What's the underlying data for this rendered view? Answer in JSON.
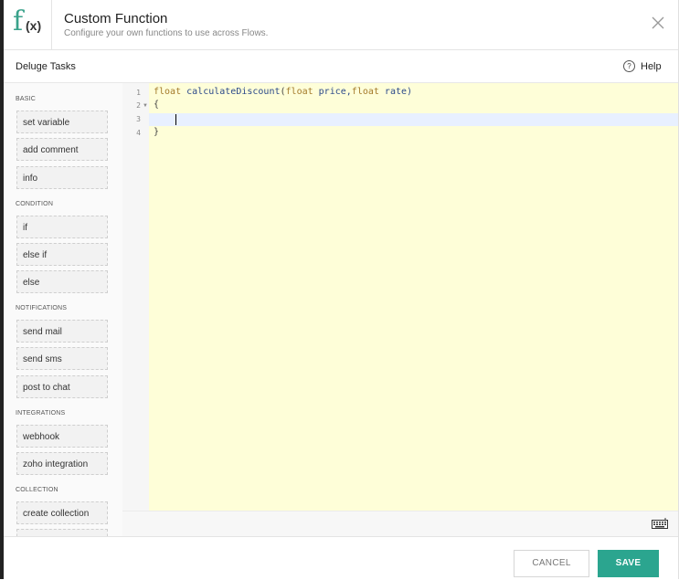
{
  "header": {
    "logo_f": "f",
    "logo_x": "(x)",
    "title": "Custom Function",
    "subtitle": "Configure your own functions to use across Flows.",
    "close_icon": "close-icon"
  },
  "subheader": {
    "title": "Deluge Tasks",
    "help_symbol": "?",
    "help_label": "Help"
  },
  "sidebar": {
    "sections": {
      "basic": {
        "label": "BASIC",
        "items": [
          "set variable",
          "add comment",
          "info"
        ]
      },
      "condition": {
        "label": "CONDITION",
        "items": [
          "if",
          "else if",
          "else"
        ]
      },
      "notifications": {
        "label": "NOTIFICATIONS",
        "items": [
          "send mail",
          "send sms",
          "post to chat"
        ]
      },
      "integrations": {
        "label": "INTEGRATIONS",
        "items": [
          "webhook",
          "zoho integration"
        ]
      },
      "collection": {
        "label": "COLLECTION",
        "items": [
          "create collection"
        ]
      }
    }
  },
  "editor": {
    "line_numbers": [
      "1",
      "2",
      "3",
      "4"
    ],
    "code": {
      "line1": {
        "kw1": "float",
        "fn": "calculateDiscount",
        "p1": "(",
        "kw2": "float",
        "a1": " price,",
        "kw3": "float",
        "a2": " rate)"
      },
      "line2": "{",
      "line4": "}"
    },
    "keyboard_icon": "keyboard-icon"
  },
  "footer": {
    "cancel_label": "CANCEL",
    "save_label": "SAVE"
  },
  "colors": {
    "accent": "#2ba58f",
    "editor_bg": "#fefed8",
    "keyword": "#a47a2a",
    "function": "#2c4a8a"
  }
}
